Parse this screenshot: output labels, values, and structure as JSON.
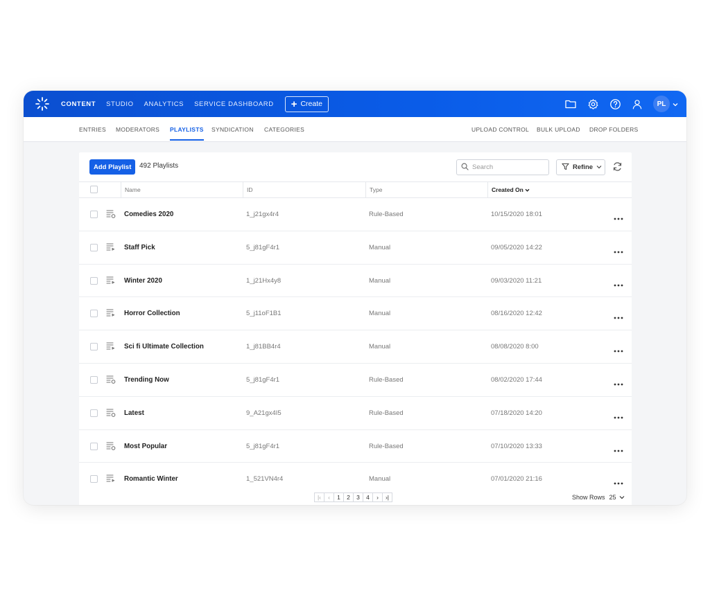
{
  "topbar": {
    "nav": [
      "CONTENT",
      "STUDIO",
      "ANALYTICS",
      "SERVICE DASHBOARD"
    ],
    "active_nav": "CONTENT",
    "create_label": "Create",
    "avatar_initials": "PL",
    "icons": [
      "folder-icon",
      "gear-icon",
      "help-icon",
      "user-icon"
    ]
  },
  "subnav": {
    "left": [
      "ENTRIES",
      "MODERATORS",
      "PLAYLISTS",
      "SYNDICATION",
      "CATEGORIES"
    ],
    "active": "PLAYLISTS",
    "right": [
      "UPLOAD CONTROL",
      "BULK UPLOAD",
      "DROP FOLDERS"
    ]
  },
  "toolbar": {
    "add_label": "Add Playlist",
    "count_label": "492 Playlists",
    "search_placeholder": "Search",
    "refine_label": "Refine"
  },
  "table": {
    "columns": [
      "Name",
      "ID",
      "Type",
      "Created On"
    ],
    "sorted_column": "Created On",
    "rows": [
      {
        "name": "Comedies 2020",
        "id": "1_j21gx4r4",
        "type": "Rule-Based",
        "created": "10/15/2020 18:01"
      },
      {
        "name": "Staff Pick",
        "id": "5_j81gF4r1",
        "type": "Manual",
        "created": "09/05/2020 14:22"
      },
      {
        "name": "Winter 2020",
        "id": "1_j21Hx4y8",
        "type": "Manual",
        "created": "09/03/2020 11:21"
      },
      {
        "name": "Horror Collection",
        "id": "5_j11oF1B1",
        "type": "Manual",
        "created": "08/16/2020 12:42"
      },
      {
        "name": "Sci fi Ultimate Collection",
        "id": "1_j81BB4r4",
        "type": "Manual",
        "created": "08/08/2020 8:00"
      },
      {
        "name": "Trending Now",
        "id": "5_j81gF4r1",
        "type": "Rule-Based",
        "created": "08/02/2020 17:44"
      },
      {
        "name": "Latest",
        "id": "9_A21gx4I5",
        "type": "Rule-Based",
        "created": "07/18/2020 14:20"
      },
      {
        "name": "Most Popular",
        "id": "5_j81gF4r1",
        "type": "Rule-Based",
        "created": "07/10/2020 13:33"
      },
      {
        "name": "Romantic Winter",
        "id": "1_521VN4r4",
        "type": "Manual",
        "created": "07/01/2020 21:16"
      }
    ]
  },
  "pagination": {
    "pages": [
      "1",
      "2",
      "3",
      "4"
    ],
    "show_rows_label": "Show Rows",
    "rows_per_page": "25"
  }
}
